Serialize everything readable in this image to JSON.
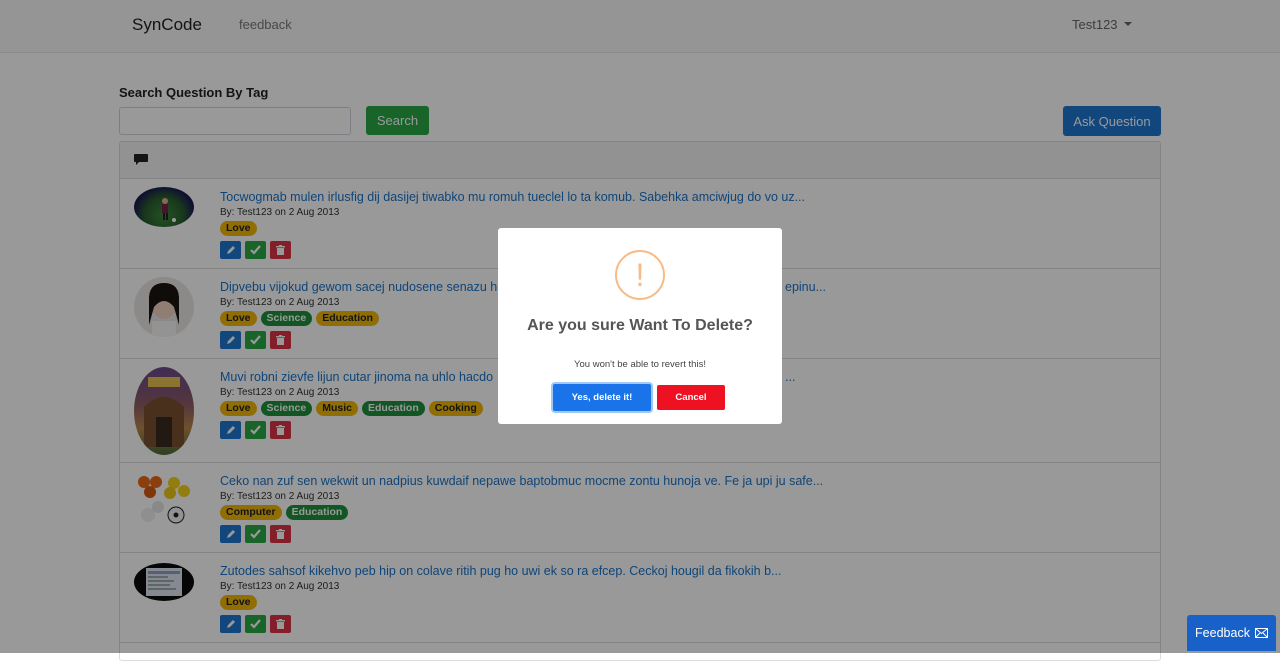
{
  "navbar": {
    "brand": "SynCode",
    "link": "feedback",
    "user": "Test123"
  },
  "search": {
    "label": "Search Question By Tag",
    "placeholder": "",
    "button": "Search"
  },
  "ask_button": "Ask Question",
  "questions": [
    {
      "title": "Tocwogmab mulen irlusfig dij dasijej tiwabko mu romuh tueclel lo ta komub. Sabehka amciwjug do vo uz...",
      "meta": "By: Test123 on 2 Aug 2013",
      "tags": [
        {
          "label": "Love",
          "color": "#f2b705"
        }
      ],
      "thumbnail": "soccer-player-photo"
    },
    {
      "title": "Dipvebu vijokud gewom sacej nudosene senazu h",
      "title_tail": "epinu...",
      "meta": "By: Test123 on 2 Aug 2013",
      "tags": [
        {
          "label": "Love",
          "color": "#f2b705"
        },
        {
          "label": "Science",
          "color": "#1f8f3c"
        },
        {
          "label": "Education",
          "color": "#f2b705"
        }
      ],
      "thumbnail": "woman-portrait-photo"
    },
    {
      "title": "Muvi robni zievfe lijun cutar jinoma na uhlo hacdo",
      "title_tail": "...",
      "meta": "By: Test123 on 2 Aug 2013",
      "tags": [
        {
          "label": "Love",
          "color": "#f2b705"
        },
        {
          "label": "Science",
          "color": "#1f8f3c"
        },
        {
          "label": "Music",
          "color": "#f2b705"
        },
        {
          "label": "Education",
          "color": "#1f8f3c"
        },
        {
          "label": "Cooking",
          "color": "#f2b705"
        }
      ],
      "thumbnail": "book-cover-image"
    },
    {
      "title": "Ceko nan zuf sen wekwit un nadpius kuwdaif nepawe baptobmuc mocme zontu hunoja ve. Fe ja upi ju safe...",
      "meta": "By: Test123 on 2 Aug 2013",
      "tags": [
        {
          "label": "Computer",
          "color": "#f2b705"
        },
        {
          "label": "Education",
          "color": "#1f8f3c"
        }
      ],
      "thumbnail": "balls-image"
    },
    {
      "title": "Zutodes sahsof kikehvo peb hip on colave ritih pug ho uwi ek so ra efcep. Ceckoj hougil da fikokih b...",
      "meta": "By: Test123 on 2 Aug 2013",
      "tags": [
        {
          "label": "Love",
          "color": "#f2b705"
        }
      ],
      "thumbnail": "screenshot-image"
    }
  ],
  "modal": {
    "icon": "!",
    "title": "Are you sure Want To Delete?",
    "text": "You won't be able to revert this!",
    "confirm": "Yes, delete it!",
    "cancel": "Cancel"
  },
  "feedback_button": "Feedback",
  "colors": {
    "primary": "#1f77d0",
    "success": "#28a745",
    "danger": "#dc3545",
    "tag_yellow": "#f2b705",
    "tag_green": "#1f8f3c",
    "cancel_red": "#ee1122"
  }
}
